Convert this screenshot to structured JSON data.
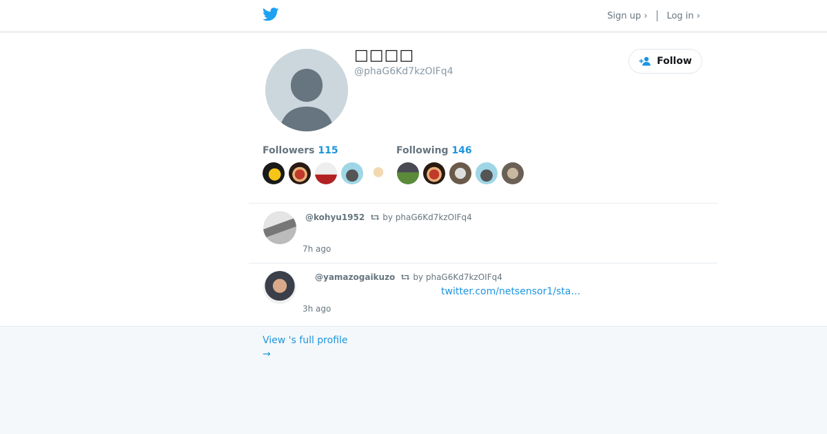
{
  "header": {
    "logo": "twitter-bird-icon",
    "signup_label": "Sign up ›",
    "login_label": "Log in ›"
  },
  "profile": {
    "display_name": "□□□□",
    "screen_name": "@phaG6Kd7kzOIFq4",
    "follow_label": "Follow",
    "followers_label": "Followers",
    "followers_count": "115",
    "following_label": "Following",
    "following_count": "146"
  },
  "tweets": [
    {
      "author": "@kohyu1952",
      "retweet_by": "by phaG6Kd7kzOIFq4",
      "time": "7h ago",
      "link": ""
    },
    {
      "author": "@yamazogaikuzo",
      "retweet_by": "by phaG6Kd7kzOIFq4",
      "time": "3h ago",
      "link": "twitter.com/netsensor1/sta…"
    }
  ],
  "footer": {
    "full_profile_label": "View 's full profile",
    "arrow": "→"
  },
  "colors": {
    "accent": "#1b95e0",
    "twitter_blue": "#1da1f2",
    "footer_bg": "#f5f8fa"
  }
}
